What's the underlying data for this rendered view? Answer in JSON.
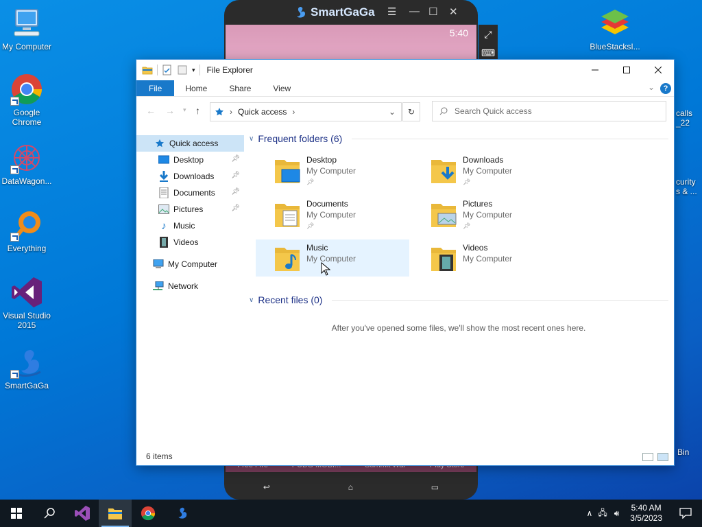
{
  "desktop": {
    "icons": [
      {
        "label": "My Computer"
      },
      {
        "label": "Google Chrome"
      },
      {
        "label": "DataWagon..."
      },
      {
        "label": "Everything"
      },
      {
        "label": "Visual Studio 2015"
      },
      {
        "label": "SmartGaGa"
      },
      {
        "label": "BlueStacksI..."
      }
    ],
    "partial_right": {
      "line1": "calls",
      "line2": "_22",
      "line3": "curity",
      "line4": "s & ...",
      "recycle": "Bin"
    }
  },
  "emulator": {
    "title": "SmartGaGa",
    "time": "5:40",
    "apps": [
      "Free Fire",
      "PUBG MOBI...",
      "Summit War",
      "Play Store"
    ]
  },
  "explorer": {
    "title": "File Explorer",
    "ribbon_tabs": [
      "File",
      "Home",
      "Share",
      "View"
    ],
    "help": "?",
    "address": {
      "location": "Quick access"
    },
    "search": {
      "placeholder": "Search Quick access"
    },
    "nav": {
      "quick_access": "Quick access",
      "items": [
        {
          "label": "Desktop",
          "pinned": true
        },
        {
          "label": "Downloads",
          "pinned": true
        },
        {
          "label": "Documents",
          "pinned": true
        },
        {
          "label": "Pictures",
          "pinned": true
        },
        {
          "label": "Music",
          "pinned": false
        },
        {
          "label": "Videos",
          "pinned": false
        }
      ],
      "my_computer": "My Computer",
      "network": "Network"
    },
    "frequent": {
      "header": "Frequent folders (6)",
      "folders": [
        {
          "name": "Desktop",
          "location": "My Computer",
          "pinned": true
        },
        {
          "name": "Downloads",
          "location": "My Computer",
          "pinned": true
        },
        {
          "name": "Documents",
          "location": "My Computer",
          "pinned": true
        },
        {
          "name": "Pictures",
          "location": "My Computer",
          "pinned": true
        },
        {
          "name": "Music",
          "location": "My Computer",
          "pinned": false
        },
        {
          "name": "Videos",
          "location": "My Computer",
          "pinned": false
        }
      ]
    },
    "recent": {
      "header": "Recent files (0)",
      "empty_message": "After you've opened some files, we'll show the most recent ones here."
    },
    "status": "6 items"
  },
  "taskbar": {
    "time": "5:40 AM",
    "date": "3/5/2023"
  },
  "colors": {
    "accent": "#1979ca",
    "selection": "#cce4f7",
    "hover": "#e5f3ff",
    "section_header": "#1e3287",
    "folder_yellow": "#f4c74a"
  }
}
